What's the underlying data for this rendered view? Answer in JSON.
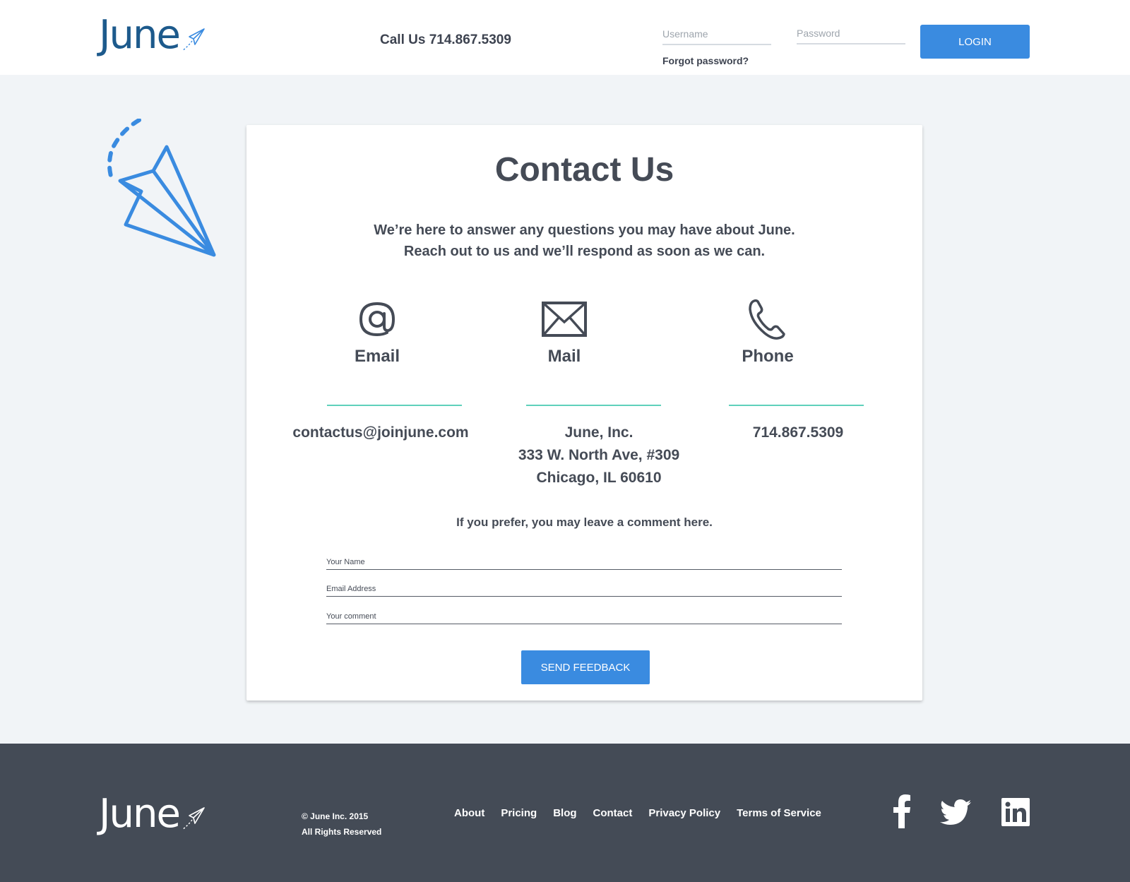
{
  "header": {
    "logo_text": "June",
    "call_us": "Call Us 714.867.5309",
    "username_placeholder": "Username",
    "password_placeholder": "Password",
    "forgot_password": "Forgot password?",
    "login_label": "LOGIN"
  },
  "contact": {
    "title": "Contact Us",
    "intro_line1": "We’re here to answer any questions you may have about June.",
    "intro_line2": "Reach out to us and we’ll respond as soon as we can.",
    "columns": [
      {
        "title": "Email",
        "icon": "at-icon",
        "lines": [
          "contactus@joinjune.com"
        ]
      },
      {
        "title": "Mail",
        "icon": "envelope-icon",
        "lines": [
          "June, Inc.",
          "333 W. North Ave, #309",
          "Chicago, IL 60610"
        ]
      },
      {
        "title": "Phone",
        "icon": "phone-icon",
        "lines": [
          "714.867.5309"
        ]
      }
    ],
    "prefer_text": "If you prefer, you may leave a comment here.",
    "form": {
      "name_placeholder": "Your Name",
      "email_placeholder": "Email Address",
      "comment_placeholder": "Your comment",
      "submit_label": "SEND FEEDBACK"
    }
  },
  "footer": {
    "logo_text": "June",
    "copyright_line1": "© June Inc. 2015",
    "copyright_line2": "All Rights Reserved",
    "nav": [
      "About",
      "Pricing",
      "Blog",
      "Contact",
      "Privacy Policy",
      "Terms of Service"
    ],
    "social": [
      "facebook-icon",
      "twitter-icon",
      "linkedin-icon"
    ]
  },
  "colors": {
    "accent": "#3a8be0",
    "divider": "#5fd1bb",
    "text": "#454b56",
    "footer_bg": "#444b56",
    "page_bg": "#f1f4f7",
    "logo_blue": "#1d5a8c"
  }
}
